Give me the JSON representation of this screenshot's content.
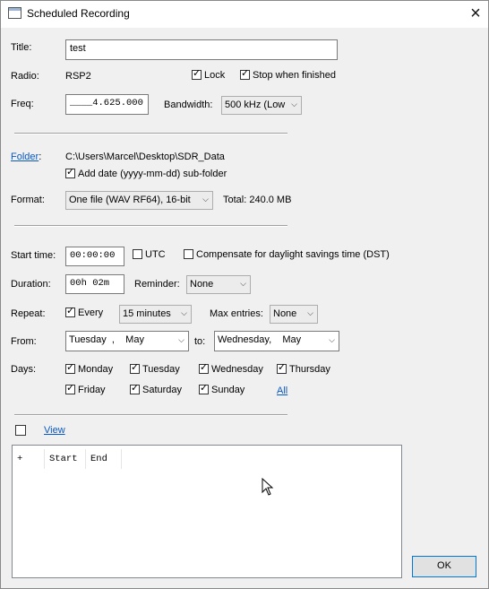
{
  "window": {
    "title": "Scheduled Recording",
    "close_symbol": "×"
  },
  "form": {
    "title_label": "Title:",
    "title_value": "test",
    "radio_label": "Radio:",
    "radio_value": "RSP2",
    "lock_label": "Lock",
    "lock_checked": true,
    "stop_label": "Stop when finished",
    "stop_checked": true,
    "freq_label": "Freq:",
    "freq_value": "____4.625.000",
    "bandwidth_label": "Bandwidth:",
    "bandwidth_value": "500 kHz (Low",
    "folder_label": "Folder",
    "folder_colon": ":",
    "folder_path": "C:\\Users\\Marcel\\Desktop\\SDR_Data",
    "add_date_label": "Add date (yyyy-mm-dd) sub-folder",
    "add_date_checked": true,
    "format_label": "Format:",
    "format_value": "One file (WAV RF64), 16-bit",
    "total_label": "Total: 240.0 MB",
    "start_time_label": "Start time:",
    "start_time_value": "00:00:00",
    "utc_label": "UTC",
    "utc_checked": false,
    "dst_label": "Compensate for daylight savings time (DST)",
    "dst_checked": false,
    "duration_label": "Duration:",
    "duration_value": "00h 02m",
    "reminder_label": "Reminder:",
    "reminder_value": "None",
    "repeat_label": "Repeat:",
    "every_label": "Every",
    "every_checked": true,
    "interval_value": "15 minutes",
    "max_entries_label": "Max entries:",
    "max_entries_value": "None",
    "from_label": "From:",
    "from_value": "Tuesday  ,    May",
    "to_label": "to:",
    "to_value": "Wednesday,    May",
    "days_label": "Days:",
    "days": [
      {
        "label": "Monday",
        "checked": true
      },
      {
        "label": "Tuesday",
        "checked": true
      },
      {
        "label": "Wednesday",
        "checked": true
      },
      {
        "label": "Thursday",
        "checked": true
      },
      {
        "label": "Friday",
        "checked": true
      },
      {
        "label": "Saturday",
        "checked": true
      },
      {
        "label": "Sunday",
        "checked": true
      }
    ],
    "all_link": "All",
    "view_checked": false,
    "view_link": "View"
  },
  "list": {
    "columns": [
      "+",
      "Start",
      "End"
    ]
  },
  "buttons": {
    "ok": "OK"
  },
  "icons": {
    "dropdown": "chevron-down-icon",
    "check": "check-icon",
    "close": "close-icon",
    "cursor": "mouse-cursor-icon"
  }
}
